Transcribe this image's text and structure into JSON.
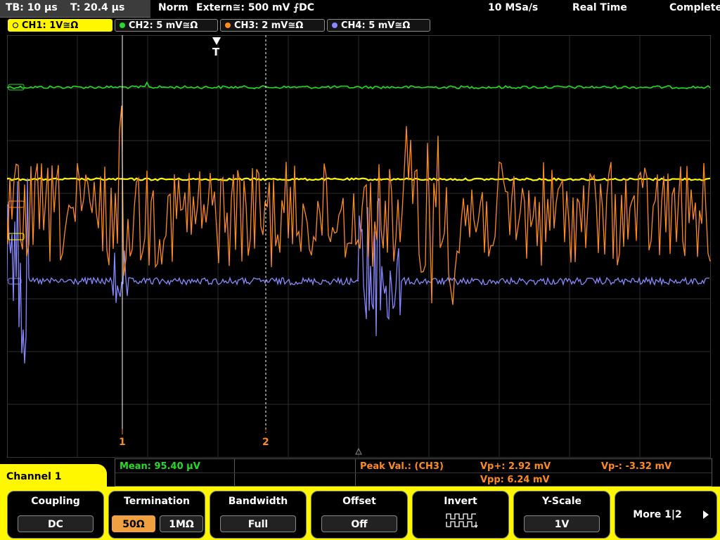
{
  "status": {
    "timebase": "TB: 10 µs",
    "trigger_time": "T: 20.4 µs",
    "mode": "Norm",
    "trigger": "Extern≅: 500 mV ⨍DC",
    "sample_rate": "10 MSa/s",
    "acq_mode": "Real Time",
    "state": "Complete"
  },
  "channels": [
    {
      "label": "CH1: 1V≅Ω",
      "color": "#fff700"
    },
    {
      "label": "CH2: 5 mV≅Ω",
      "color": "#22dd22"
    },
    {
      "label": "CH3: 2 mV≅Ω",
      "color": "#ff8a1e"
    },
    {
      "label": "CH4: 5 mV≅Ω",
      "color": "#8888ff"
    }
  ],
  "scope": {
    "trigger_marker": "T",
    "cursor1_label": "1",
    "cursor2_label": "2"
  },
  "measurements": {
    "mean": "Mean: 95.40 µV",
    "peak_label": "Peak Val.:  (CH3)",
    "vp_plus": "Vp+: 2.92 mV",
    "vp_minus": "Vp-: -3.32 mV",
    "vpp": "Vpp: 6.24 mV"
  },
  "menu": {
    "panel_title": "Channel 1",
    "softkeys": [
      {
        "title": "Coupling",
        "value": "DC"
      },
      {
        "title": "Termination",
        "option_a": "50Ω",
        "option_b": "1MΩ"
      },
      {
        "title": "Bandwidth",
        "value": "Full"
      },
      {
        "title": "Offset",
        "value": "Off"
      },
      {
        "title": "Invert",
        "icon": "invert-waveform-icon"
      },
      {
        "title": "Y-Scale",
        "value": "1V"
      },
      {
        "title": "More 1|2"
      }
    ]
  }
}
